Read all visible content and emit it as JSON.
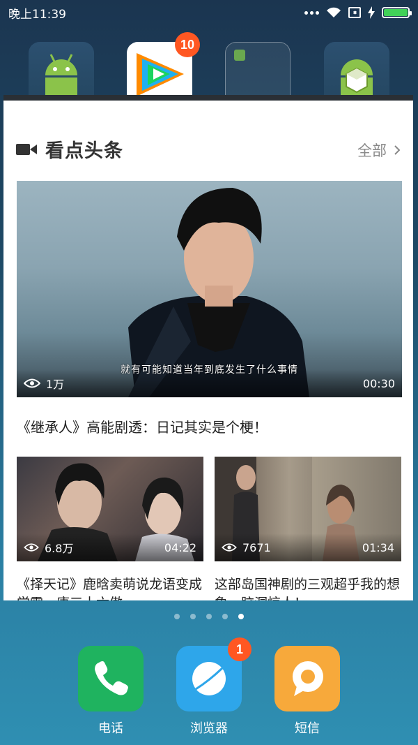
{
  "status_bar": {
    "time": "晚上11:39"
  },
  "top_apps": {
    "tencent_badge": "10"
  },
  "card": {
    "title": "看点头条",
    "all_link": "全部",
    "hero": {
      "subtitle": "就有可能知道当年到底发生了什么事情",
      "views": "1万",
      "duration": "00:30",
      "caption": "《继承人》高能剧透：日记其实是个梗！"
    },
    "videos": [
      {
        "views": "6.8万",
        "duration": "04:22",
        "caption": "《择天记》鹿晗卖萌说龙语变成学霸，唐三十六傲"
      },
      {
        "views": "7671",
        "duration": "01:34",
        "caption": "这部岛国神剧的三观超乎我的想象，脑洞惊人！"
      }
    ]
  },
  "dock": {
    "apps": [
      {
        "label": "电话",
        "color": "#1fb35f"
      },
      {
        "label": "浏览器",
        "color": "#2ea6ea",
        "badge": "1"
      },
      {
        "label": "短信",
        "color": "#f7a93b"
      }
    ]
  }
}
